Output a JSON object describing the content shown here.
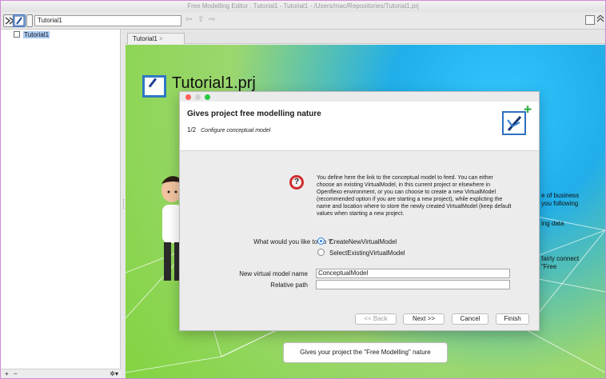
{
  "window": {
    "title": "Free Modelling Editor : Tutorial1 - Tutorial1 - /Users/mac/Repositories/Tutorial1.prj"
  },
  "toolbar": {
    "project": "Tutorial1"
  },
  "sidebar": {
    "selected_item": "Tutorial1"
  },
  "tab": {
    "label": "Tutorial1"
  },
  "editor": {
    "title": "Tutorial1.prj",
    "right_lines": [
      "e of business",
      "you following",
      "ing data",
      "fairly connect",
      "\"Free"
    ],
    "bottom_button": "Gives your project the \"Free Modelling\" nature"
  },
  "dialog": {
    "title": "Gives project free modelling nature",
    "step_number": "1/2",
    "step_desc": "Configure conceptual model",
    "description": "You define here the link to the conceptual model to feed. You can either choose an existing VirtualModel, in this current project or elsewhere in Openflexo environment, or you can choose to create a new VirtualModel (recommended option if you are starting a new project), while explicting the name and location where to store the newly created VirtualModel (keep default values when starting a new project.",
    "question": "What would you like to do ?",
    "options": [
      "CreateNewVirtualModel",
      "SelectExistingVirtualModel"
    ],
    "new_name_label": "New virtual model name",
    "new_name_value": "ConceptualModel",
    "relative_path_label": "Relative path",
    "relative_path_value": "",
    "buttons": {
      "back": "<< Back",
      "next": "Next >>",
      "cancel": "Cancel",
      "finish": "Finish"
    }
  },
  "footer": {
    "add": "+",
    "remove": "−",
    "menu": "✲▾"
  }
}
